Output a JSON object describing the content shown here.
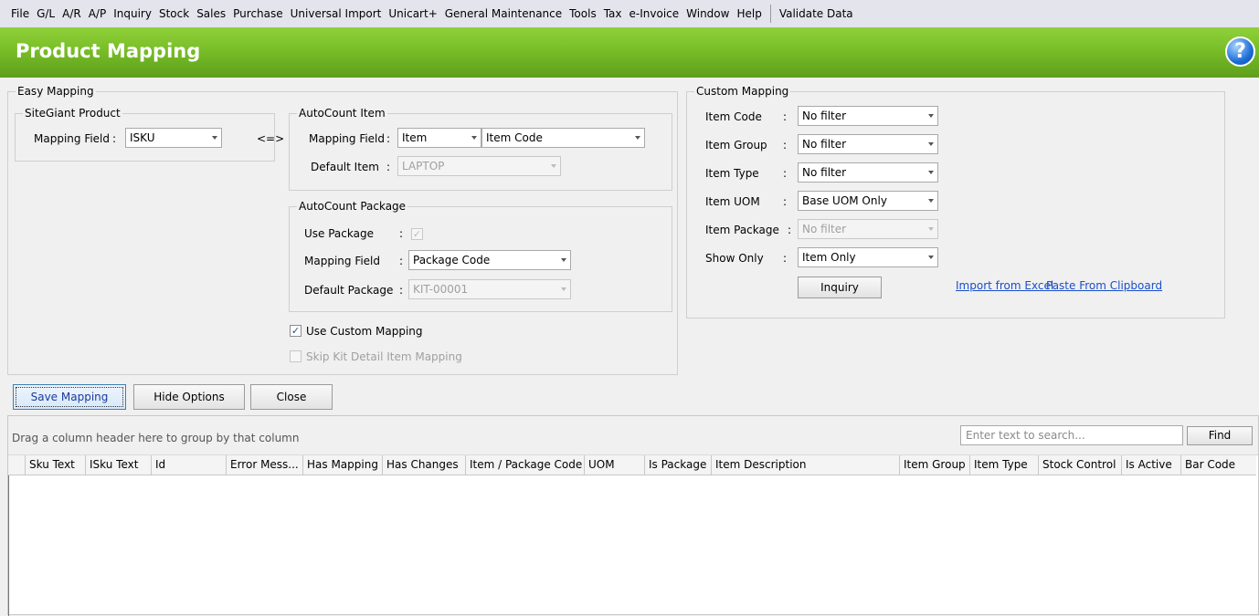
{
  "menu": [
    "File",
    "G/L",
    "A/R",
    "A/P",
    "Inquiry",
    "Stock",
    "Sales",
    "Purchase",
    "Universal Import",
    "Unicart+",
    "General Maintenance",
    "Tools",
    "Tax",
    "e-Invoice",
    "Window",
    "Help"
  ],
  "menu_extra": "Validate Data",
  "page_title": "Product Mapping",
  "help_glyph": "?",
  "easy": {
    "title": "Easy Mapping",
    "sitegiant": {
      "title": "SiteGiant Product",
      "mapping_label": "Mapping Field",
      "mapping_value": "ISKU"
    },
    "arrow": "<=>",
    "autocount_item": {
      "title": "AutoCount Item",
      "mapping_label": "Mapping Field",
      "mapping_value_1": "Item",
      "mapping_value_2": "Item Code",
      "default_label": "Default Item",
      "default_value": "LAPTOP"
    },
    "autocount_package": {
      "title": "AutoCount Package",
      "use_label": "Use Package",
      "mapping_label": "Mapping Field",
      "mapping_value": "Package Code",
      "default_label": "Default Package",
      "default_value": "KIT-00001"
    },
    "use_custom": "Use Custom Mapping",
    "skip_kit": "Skip Kit Detail Item Mapping",
    "colon": ":"
  },
  "custom": {
    "title": "Custom Mapping",
    "rows": [
      {
        "label": "Item Code",
        "value": "No filter"
      },
      {
        "label": "Item Group",
        "value": "No filter"
      },
      {
        "label": "Item Type",
        "value": "No filter"
      },
      {
        "label": "Item UOM",
        "value": "Base UOM Only"
      },
      {
        "label": "Item Package",
        "value": "No filter"
      },
      {
        "label": "Show Only",
        "value": "Item Only"
      }
    ],
    "inquiry": "Inquiry",
    "import_excel": "Import from Excel",
    "paste_clipboard": "Paste From Clipboard"
  },
  "buttons": {
    "save": "Save Mapping",
    "hide": "Hide Options",
    "close": "Close"
  },
  "grid": {
    "group_hint": "Drag a column header here to group by that column",
    "search_placeholder": "Enter text to search...",
    "find": "Find",
    "columns": [
      "",
      "Sku Text",
      "ISku Text",
      "Id",
      "Error Mess...",
      "Has Mapping",
      "Has Changes",
      "Item / Package Code",
      "UOM",
      "Is Package",
      "Item Description",
      "Item Group",
      "Item Type",
      "Stock Control",
      "Is Active",
      "Bar Code"
    ]
  }
}
